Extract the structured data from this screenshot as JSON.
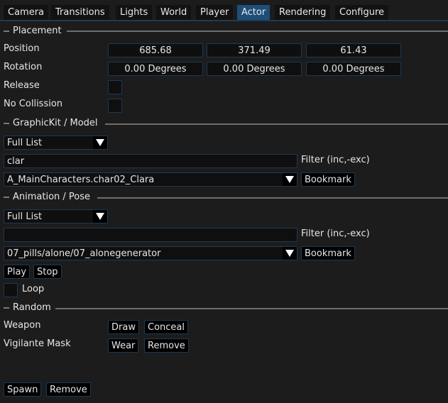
{
  "tabs": [
    {
      "label": "Camera",
      "active": false
    },
    {
      "label": "Transitions",
      "active": false
    },
    {
      "label": "Lights",
      "active": false
    },
    {
      "label": "World",
      "active": false
    },
    {
      "label": "Player",
      "active": false
    },
    {
      "label": "Actor",
      "active": true
    },
    {
      "label": "Rendering",
      "active": false
    },
    {
      "label": "Configure",
      "active": false
    }
  ],
  "placement": {
    "title": "Placement",
    "position_label": "Position",
    "position": [
      "685.68",
      "371.49",
      "61.43"
    ],
    "rotation_label": "Rotation",
    "rotation": [
      "0.00 Degrees",
      "0.00 Degrees",
      "0.00 Degrees"
    ],
    "release_label": "Release",
    "release_checked": false,
    "no_collision_label": "No Collission",
    "no_collision_checked": false
  },
  "model": {
    "title": "GraphicKit / Model",
    "list_mode": "Full List",
    "filter_value": "clar",
    "filter_label": "Filter (inc,-exc)",
    "selected": "A_MainCharacters.char02_Clara",
    "bookmark_label": "Bookmark"
  },
  "animation": {
    "title": "Animation / Pose",
    "list_mode": "Full List",
    "filter_value": "",
    "filter_label": "Filter (inc,-exc)",
    "selected": "07_pills/alone/07_alonegenerator",
    "bookmark_label": "Bookmark",
    "play_label": "Play",
    "stop_label": "Stop",
    "loop_label": "Loop",
    "loop_checked": false
  },
  "random": {
    "title": "Random",
    "weapon_label": "Weapon",
    "draw_label": "Draw",
    "conceal_label": "Conceal",
    "mask_label": "Vigilante Mask",
    "wear_label": "Wear",
    "remove_label": "Remove"
  },
  "footer": {
    "spawn_label": "Spawn",
    "remove_label": "Remove"
  }
}
